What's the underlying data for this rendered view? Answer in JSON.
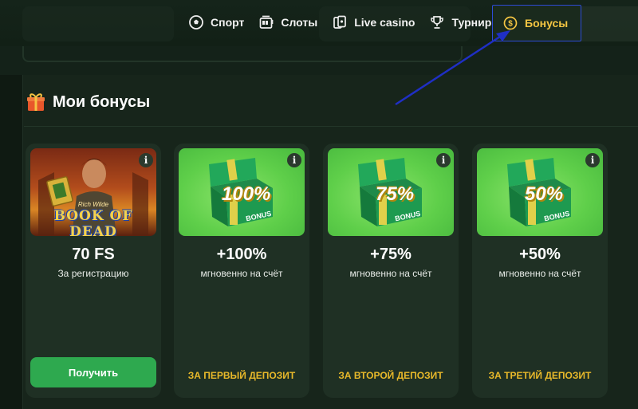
{
  "nav": {
    "items": [
      {
        "label": "Спорт",
        "icon": "soccer-ball-icon"
      },
      {
        "label": "Слоты",
        "icon": "slot-machine-icon"
      },
      {
        "label": "Live casino",
        "icon": "cards-icon"
      },
      {
        "label": "Турниры",
        "icon": "trophy-icon"
      },
      {
        "label": "Бонусы",
        "icon": "coin-icon"
      }
    ],
    "active_color": "#f4c542",
    "highlight_color": "#2d4bd6"
  },
  "section": {
    "title": "Мои бонусы",
    "icon": "gift-icon"
  },
  "cards": [
    {
      "image": "book-of-dead-image",
      "image_title": "BOOK OF DEAD",
      "image_subtitle": "Rich Wilde",
      "amount": "70 FS",
      "description": "За регистрацию",
      "button_label": "Получить"
    },
    {
      "image": "bonus-chest-image",
      "image_percent": "100%",
      "image_label": "BONUS",
      "amount": "+100%",
      "description": "мгновенно на счёт",
      "condition": "ЗА ПЕРВЫЙ ДЕПОЗИТ"
    },
    {
      "image": "bonus-chest-image",
      "image_percent": "75%",
      "image_label": "BONUS",
      "amount": "+75%",
      "description": "мгновенно на счёт",
      "condition": "ЗА ВТОРОЙ ДЕПОЗИТ"
    },
    {
      "image": "bonus-chest-image",
      "image_percent": "50%",
      "image_label": "BONUS",
      "amount": "+50%",
      "description": "мгновенно на счёт",
      "condition": "ЗА ТРЕТИЙ ДЕПОЗИТ"
    }
  ],
  "info_icon_glyph": "i",
  "colors": {
    "button_green": "#2ea94f",
    "condition_gold": "#e9b92a",
    "arrow_blue": "#1f2fc4"
  }
}
